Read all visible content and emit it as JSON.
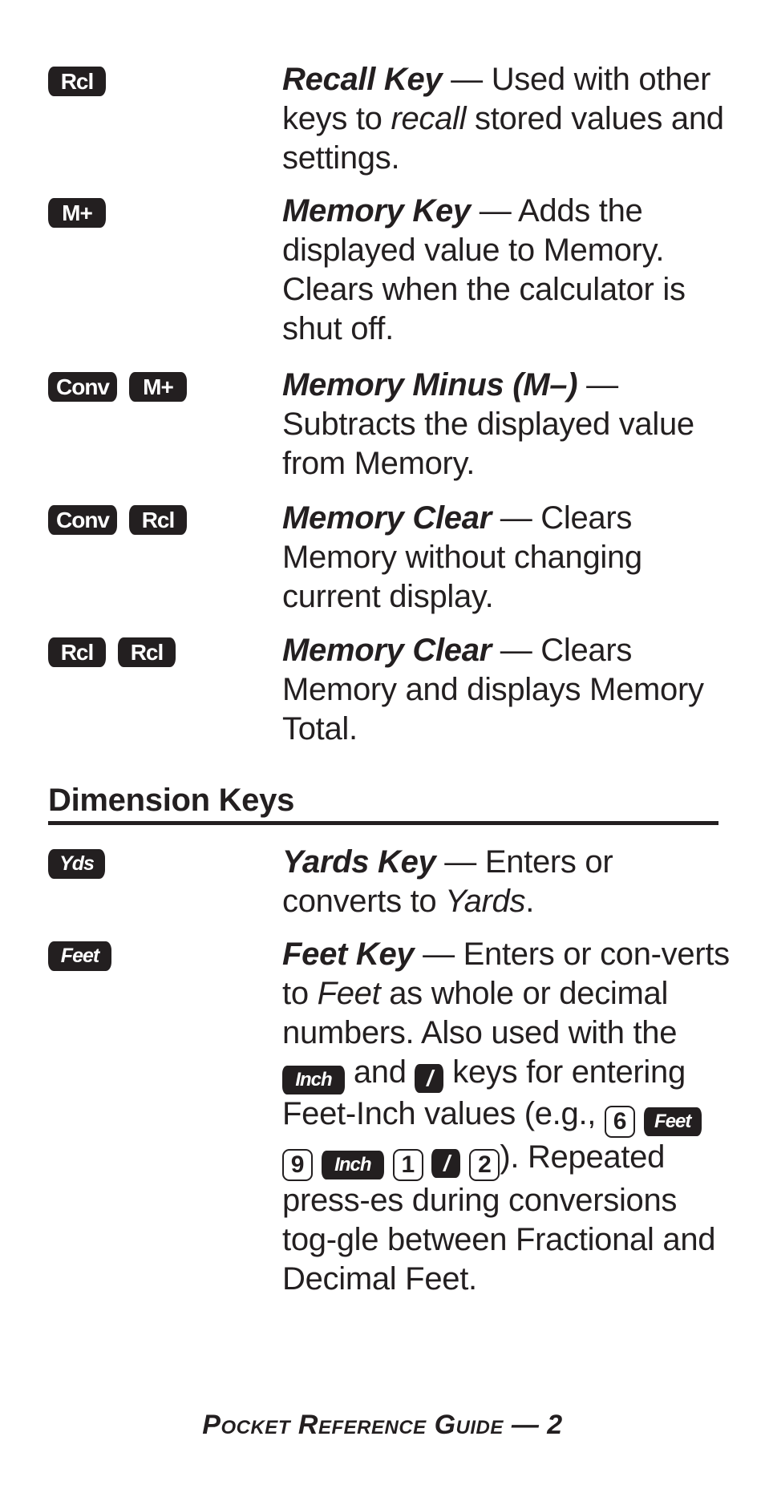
{
  "memory_entries": [
    {
      "keys": [
        "Rcl"
      ],
      "title": "Recall Key",
      "dash": " — ",
      "text_a": "Used with other keys to ",
      "italic": "recall",
      "text_b": " stored values and settings."
    },
    {
      "keys": [
        "M+"
      ],
      "title": "Memory Key",
      "dash": " — ",
      "text_a": "Adds the displayed value to Memory. Clears when the calculator is shut off."
    },
    {
      "keys": [
        "Conv",
        "M+"
      ],
      "title": "Memory Minus (M–)",
      "dash": " — ",
      "text_a": "Subtracts the displayed value from Memory."
    },
    {
      "keys": [
        "Conv",
        "Rcl"
      ],
      "title": "Memory Clear",
      "dash": " — ",
      "text_a": "Clears Memory without changing current display."
    },
    {
      "keys": [
        "Rcl",
        "Rcl"
      ],
      "title": "Memory Clear",
      "dash": " — ",
      "text_a": "Clears Memory and displays Memory Total."
    }
  ],
  "dimension_section": {
    "heading": "Dimension Keys",
    "entries": [
      {
        "keys": [
          "Yds"
        ],
        "title": "Yards Key",
        "dash": " — ",
        "text_a": "Enters or converts to ",
        "italic": "Yards",
        "text_b": "."
      },
      {
        "keys": [
          "Feet"
        ],
        "title": "Feet Key",
        "dash": " — ",
        "text_a": "Enters or con-verts to ",
        "italic": "Feet",
        "text_b": " as whole or decimal numbers. Also used with the ",
        "inline_key_inch": "Inch",
        "text_c": " and ",
        "inline_key_slash": "/",
        "text_d": " keys for entering Feet-Inch values (e.g., ",
        "example_keys": [
          "6",
          "Feet",
          "9",
          "Inch",
          "1",
          "/",
          "2"
        ],
        "text_e": "). Repeated press-es during conversions tog-gle between Fractional and Decimal Feet."
      }
    ]
  },
  "footer": {
    "text": "Pocket Reference Guide — 2"
  }
}
